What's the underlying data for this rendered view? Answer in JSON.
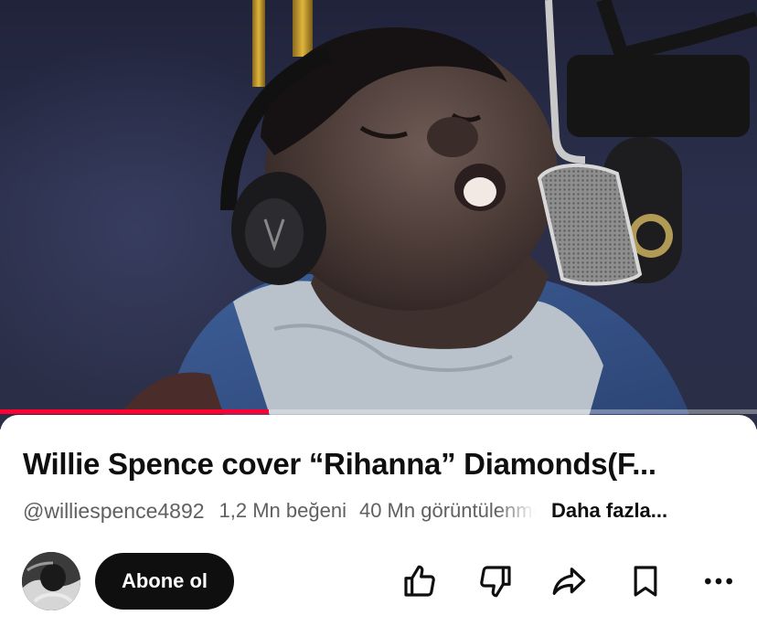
{
  "video": {
    "progress_fraction": 0.355
  },
  "info": {
    "title": "Willie Spence cover “Rihanna” Diamonds(F...",
    "channel_handle": "@williespence4892",
    "likes": "1,2 Mn beğeni",
    "views": "40 Mn görüntülenme",
    "more_label": "Daha fazla..."
  },
  "actions": {
    "subscribe_label": "Abone ol",
    "icons": [
      "thumbs-up-icon",
      "thumbs-down-icon",
      "share-icon",
      "save-icon",
      "more-icon"
    ]
  },
  "colors": {
    "progress": "#ff0033",
    "subscribe_bg": "#0f0f0f",
    "meta_text": "#606060"
  }
}
